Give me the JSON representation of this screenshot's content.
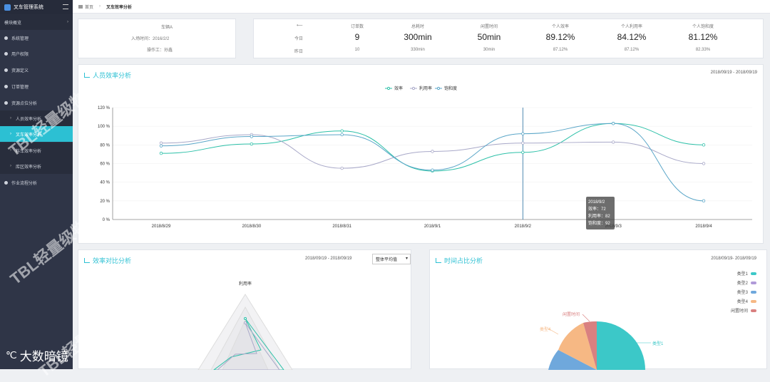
{
  "brand": {
    "name": "叉车管理系统",
    "corner_logo": "大数暗镜"
  },
  "watermark": "TBL轻量级物流",
  "sidebar": {
    "items": [
      {
        "label": "模块概览",
        "icon": "grid-icon"
      },
      {
        "label": "系统管理",
        "icon": "gear-icon"
      },
      {
        "label": "用户权限",
        "icon": "user-icon"
      },
      {
        "label": "资源定义",
        "icon": "database-icon"
      },
      {
        "label": "订单管理",
        "icon": "order-icon"
      },
      {
        "label": "资源点位分析",
        "icon": "location-icon"
      },
      {
        "label": "人员效率分析",
        "icon": ""
      },
      {
        "label": "叉车效率分析",
        "icon": ""
      },
      {
        "label": "料车效率分析",
        "icon": ""
      },
      {
        "label": "库区效率分析",
        "icon": ""
      },
      {
        "label": "作业流程分析",
        "icon": "flow-icon"
      }
    ]
  },
  "breadcrumb": {
    "home": "首页",
    "current": "叉车效率分析"
  },
  "info": {
    "car": "车辆A",
    "entry_label": "入场时间：2016/2/2",
    "operator_label": "操作工：孙鑫"
  },
  "stats": {
    "headers": [
      "订单数",
      "总耗时",
      "闲置时间",
      "个人效率",
      "个人利用率",
      "个人饱和度"
    ],
    "row_today_label": "今日",
    "row_yesterday_label": "昨日",
    "today": [
      "9",
      "300min",
      "50min",
      "89.12%",
      "84.12%",
      "81.12%"
    ],
    "yesterday": [
      "10",
      "330min",
      "30min",
      "87.12%",
      "87.12%",
      "82.33%"
    ],
    "arrow": "⟵"
  },
  "line_chart": {
    "title": "人员效率分析",
    "date_range": "2018/09/19 - 2018/09/19",
    "legend": [
      "效率",
      "利用率",
      "饱和度"
    ]
  },
  "chart_data": {
    "type": "line",
    "categories": [
      "2018/8/29",
      "2018/8/30",
      "2018/8/31",
      "2018/9/1",
      "2018/9/2",
      "2018/9/3",
      "2018/9/4"
    ],
    "yticks": [
      "0 %",
      "20 %",
      "40 %",
      "60 %",
      "80 %",
      "100 %",
      "120 %"
    ],
    "ylim": [
      0,
      120
    ],
    "series": [
      {
        "name": "效率",
        "values": [
          71,
          81,
          95,
          52,
          72,
          103,
          80
        ],
        "color": "#2cc0a8"
      },
      {
        "name": "利用率",
        "values": [
          82,
          91,
          55,
          73,
          82,
          83,
          60
        ],
        "color": "#a8a8c8"
      },
      {
        "name": "饱和度",
        "values": [
          79,
          89,
          91,
          53,
          92,
          103,
          20
        ],
        "color": "#5aa6c8"
      }
    ]
  },
  "tooltip": {
    "date": "2018/9/2",
    "l1": "效率：72",
    "l2": "利用率：82",
    "l3": "饱和度：92"
  },
  "radar": {
    "title": "效率对比分析",
    "date_range": "2018/09/19 - 2018/09/19",
    "select": "整体平均值",
    "axis_label": "利用率"
  },
  "pie": {
    "title": "时间占比分析",
    "date_range": "2018/09/19- 2018/09/19",
    "legend": [
      {
        "name": "类型1",
        "color": "#3cc8c8"
      },
      {
        "name": "类型2",
        "color": "#b09ad8"
      },
      {
        "name": "类型3",
        "color": "#6fa8dc"
      },
      {
        "name": "类型4",
        "color": "#f6b884"
      },
      {
        "name": "闲置时间",
        "color": "#d98080"
      }
    ],
    "labels": {
      "idle": "闲置时间",
      "type4": "类型4",
      "type1": "类型1"
    }
  }
}
